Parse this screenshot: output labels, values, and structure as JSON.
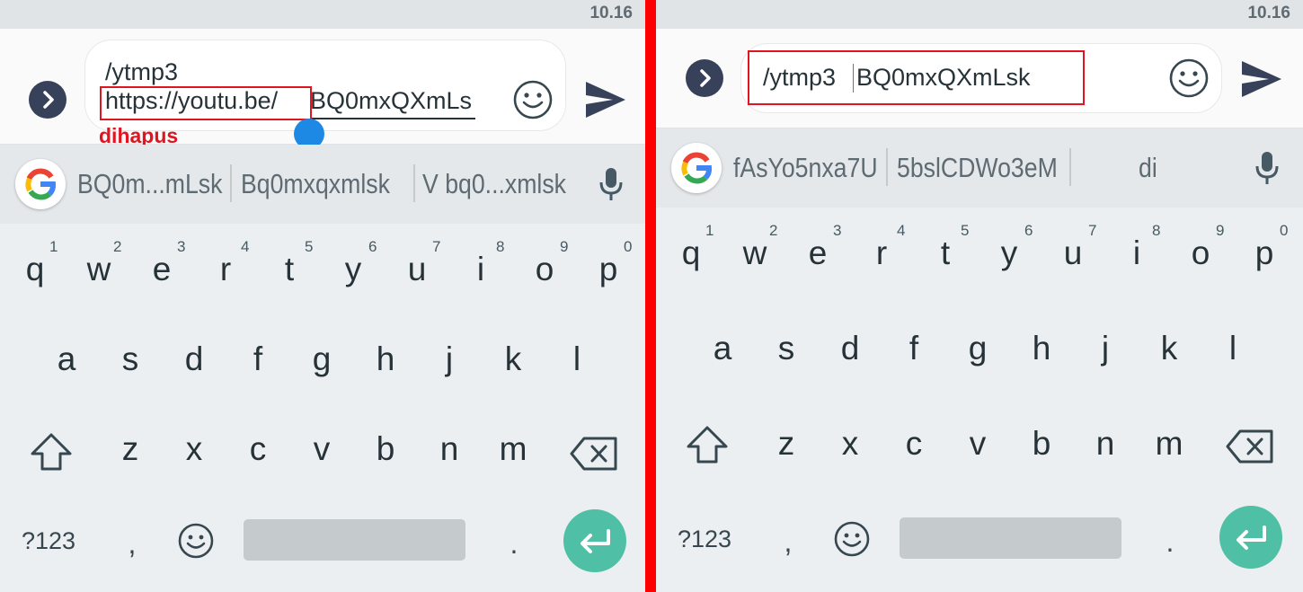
{
  "colors": {
    "divider": "#ff0000",
    "annotation": "#e0151f",
    "enter": "#4fbfa5",
    "handle": "#1e88e5"
  },
  "left": {
    "status_time": "10.16",
    "message_line1": "/ytmp3",
    "message_url": "https://youtu.be/",
    "message_id": "BQ0mxQXmLs",
    "annotation": "dihapus",
    "suggestions": [
      "BQ0m...mLsk",
      "Bq0mxqxmlsk",
      "V bq0...xmlsk"
    ]
  },
  "right": {
    "status_time": "10.16",
    "message_cmd": "/ytmp3",
    "message_id": "BQ0mxQXmLsk",
    "suggestions": [
      "fAsYo5nxa7U",
      "5bslCDWo3eM",
      "di"
    ]
  },
  "keyboard": {
    "row1": [
      "q",
      "w",
      "e",
      "r",
      "t",
      "y",
      "u",
      "i",
      "o",
      "p"
    ],
    "row1_nums": [
      "1",
      "2",
      "3",
      "4",
      "5",
      "6",
      "7",
      "8",
      "9",
      "0"
    ],
    "row2": [
      "a",
      "s",
      "d",
      "f",
      "g",
      "h",
      "j",
      "k",
      "l"
    ],
    "row3": [
      "z",
      "x",
      "c",
      "v",
      "b",
      "n",
      "m"
    ],
    "symbols_label": "?123",
    "comma": ",",
    "period": "."
  },
  "icons": [
    "expand-icon",
    "emoji-icon",
    "send-icon",
    "google-icon",
    "mic-icon",
    "shift-icon",
    "backspace-icon",
    "emoji-key-icon",
    "enter-icon"
  ]
}
